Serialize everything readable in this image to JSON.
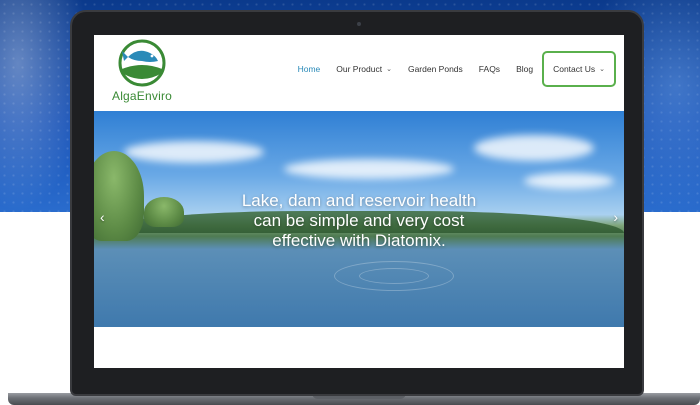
{
  "site": {
    "logo_text": "AlgaEnviro"
  },
  "nav": {
    "home": "Home",
    "our_product": "Our Product",
    "garden_ponds": "Garden Ponds",
    "faqs": "FAQs",
    "blog": "Blog",
    "contact_us": "Contact Us",
    "chevron": "⌄"
  },
  "hero": {
    "line1": "Lake, dam and reservoir health",
    "line2": "can be simple and very cost",
    "line3": "effective with Diatomix.",
    "prev_arrow": "‹",
    "next_arrow": "›"
  },
  "colors": {
    "accent_blue": "#2a8ab8",
    "brand_green": "#3a8a35",
    "button_border": "#5ab04c"
  }
}
